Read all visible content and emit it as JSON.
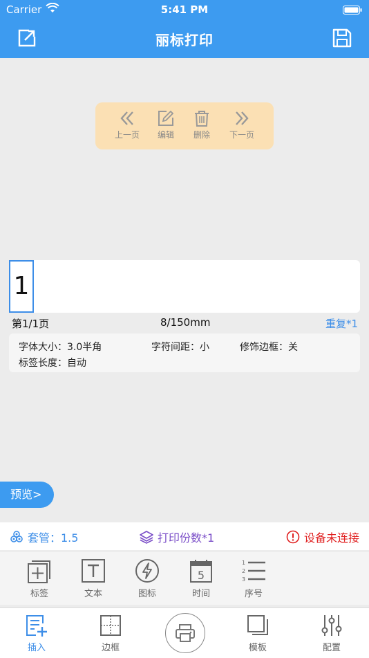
{
  "status_bar": {
    "carrier": "Carrier",
    "time": "5:41 PM"
  },
  "nav": {
    "title": "丽标打印"
  },
  "edit_toolbar": {
    "prev": "上一页",
    "edit": "编辑",
    "delete": "删除",
    "next": "下一页"
  },
  "label": {
    "cells": [
      "1"
    ],
    "page": "第1/1页",
    "length": "8/150mm",
    "repeat": "重复*1"
  },
  "properties": {
    "font_size": "字体大小：3.0半角",
    "char_spacing": "字符间距：小",
    "border": "修饰边框：关",
    "label_length": "标签长度：自动"
  },
  "preview_label": "预览>",
  "info_bar": {
    "sleeve": "套管：1.5",
    "copies": "打印份数*1",
    "device": "设备未连接"
  },
  "insert": {
    "label": "标签",
    "text": "文本",
    "icon": "图标",
    "time": "时间",
    "serial": "序号"
  },
  "tabs": {
    "insert": "插入",
    "border": "边框",
    "template": "模板",
    "config": "配置"
  },
  "colors": {
    "primary": "#3d9bf0",
    "toolbar_bg": "#fbe0b4",
    "warning": "#e02020",
    "copies": "#7b4fc8"
  }
}
